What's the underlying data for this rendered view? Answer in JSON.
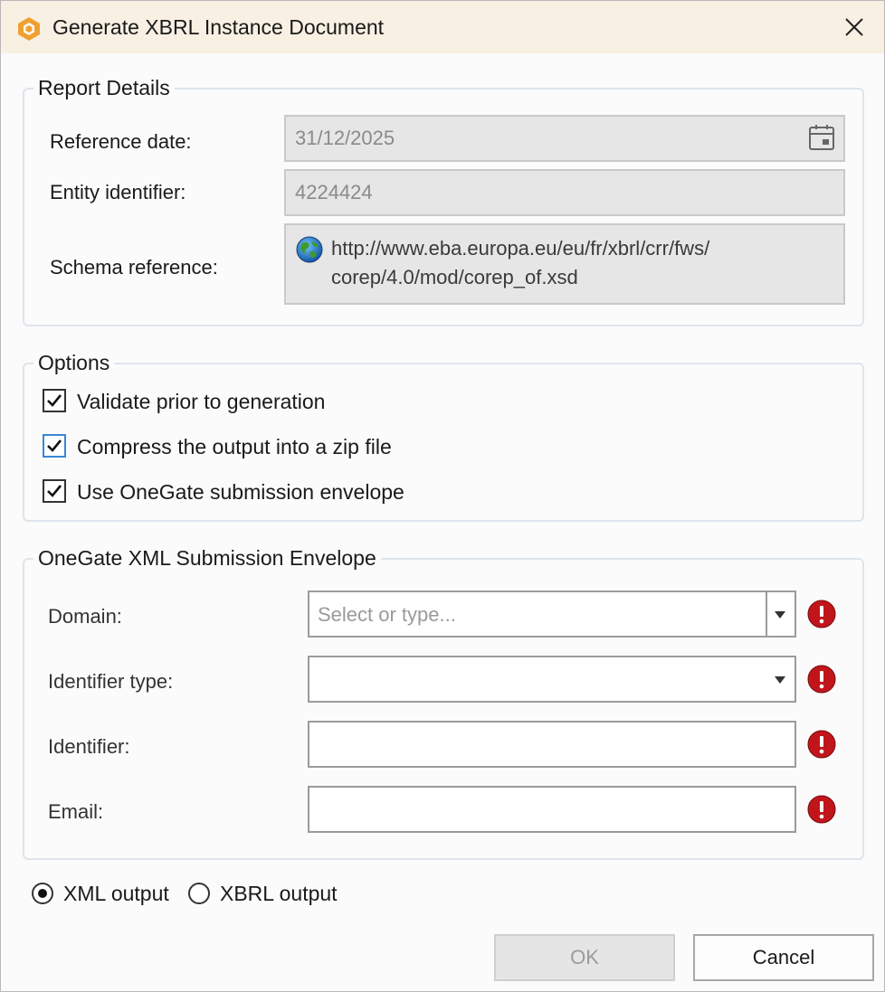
{
  "window": {
    "title": "Generate XBRL Instance Document",
    "accent": "#f0a030"
  },
  "report_details": {
    "legend": "Report Details",
    "reference_date_label": "Reference date:",
    "reference_date_value": "31/12/2025",
    "entity_identifier_label": "Entity identifier:",
    "entity_identifier_value": "4224424",
    "schema_reference_label": "Schema reference:",
    "schema_reference_line1": "http://www.eba.europa.eu/eu/fr/xbrl/crr/fws/",
    "schema_reference_line2": "corep/4.0/mod/corep_of.xsd"
  },
  "options": {
    "legend": "Options",
    "items": [
      {
        "label": "Validate prior to generation",
        "checked": true
      },
      {
        "label": "Compress the output into a zip file",
        "checked": true
      },
      {
        "label": "Use OneGate submission envelope",
        "checked": true
      }
    ]
  },
  "envelope": {
    "legend": "OneGate XML Submission Envelope",
    "domain_label": "Domain:",
    "domain_placeholder": "Select or type...",
    "identifier_type_label": "Identifier type:",
    "identifier_type_value": "",
    "identifier_label": "Identifier:",
    "identifier_value": "",
    "email_label": "Email:",
    "email_value": "",
    "error_color": "#c0161b"
  },
  "output": {
    "xml_label": "XML output",
    "xbrl_label": "XBRL output",
    "selected": "xml"
  },
  "buttons": {
    "ok_label": "OK",
    "cancel_label": "Cancel"
  }
}
